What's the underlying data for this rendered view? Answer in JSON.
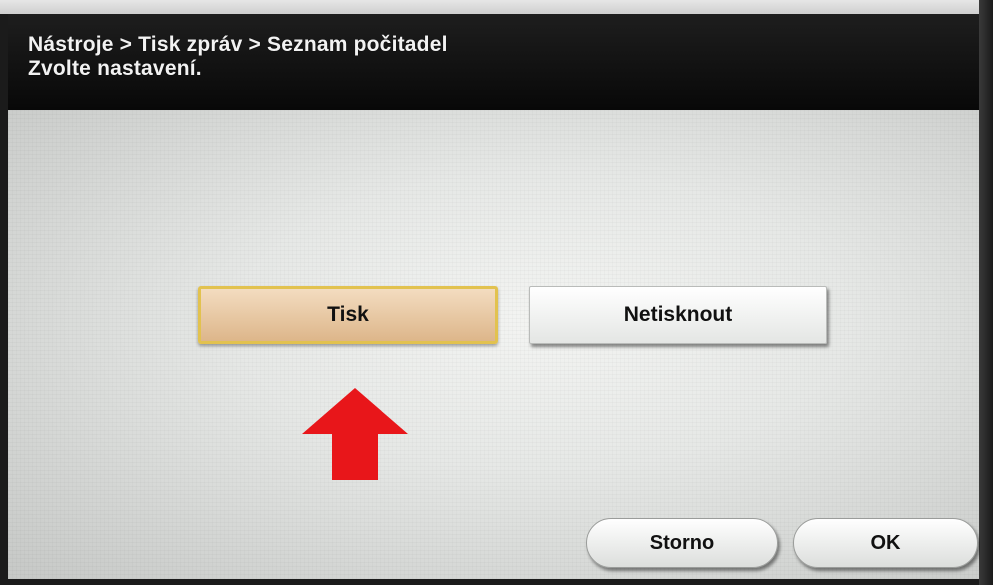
{
  "header": {
    "breadcrumb": "Nástroje > Tisk zpráv > Seznam počitadel",
    "instruction": "Zvolte nastavení."
  },
  "options": [
    {
      "label": "Tisk",
      "selected": true
    },
    {
      "label": "Netisknout",
      "selected": false
    }
  ],
  "footer": {
    "cancel_label": "Storno",
    "ok_label": "OK"
  },
  "colors": {
    "arrow": "#e8161a",
    "selected_border": "#e2c24f",
    "header_bg": "#101010"
  },
  "icons": {
    "arrow": "arrow-up-icon"
  }
}
